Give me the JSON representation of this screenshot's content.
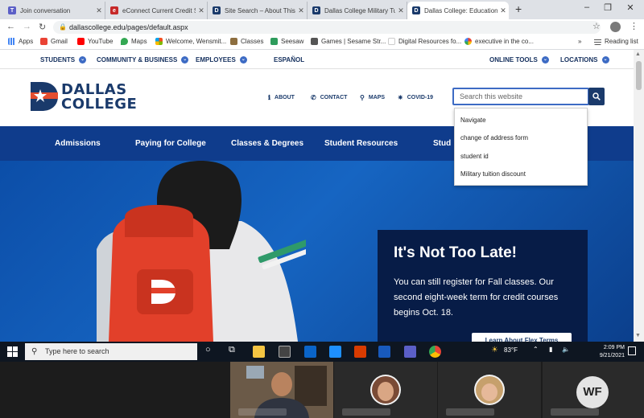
{
  "browser": {
    "tabs": [
      {
        "label": "Join conversation",
        "fav_color": "#5b5fc7",
        "fav_glyph": "T"
      },
      {
        "label": "eConnect Current Credit S",
        "fav_color": "#c62828",
        "fav_glyph": "e"
      },
      {
        "label": "Site Search – About This",
        "fav_color": "#1a3a6b",
        "fav_glyph": "D"
      },
      {
        "label": "Dallas College Military Tu",
        "fav_color": "#1a3a6b",
        "fav_glyph": "D"
      },
      {
        "label": "Dallas College: Education",
        "fav_color": "#1a3a6b",
        "fav_glyph": "D"
      }
    ],
    "new_tab": "+",
    "url": "dallascollege.edu/pages/default.aspx",
    "bookmarks": [
      {
        "label": "Apps",
        "color": "#4285f4"
      },
      {
        "label": "Gmail",
        "color": "#ea4335"
      },
      {
        "label": "YouTube",
        "color": "#ff0000"
      },
      {
        "label": "Maps",
        "color": "#34a853"
      },
      {
        "label": "Welcome, Wensmit...",
        "color": "#f4b400"
      },
      {
        "label": "Classes",
        "color": "#8d6e3f"
      },
      {
        "label": "Seesaw",
        "color": "#2e9c5c"
      },
      {
        "label": "Games | Sesame Str...",
        "color": "#555555"
      },
      {
        "label": "Digital Resources fo...",
        "color": "#ffffff"
      },
      {
        "label": "executive in the co...",
        "color": "#4285f4"
      }
    ],
    "more_bookmarks": "»",
    "reading_list": "Reading list"
  },
  "site": {
    "utility_nav": {
      "left": [
        "STUDENTS",
        "COMMUNITY & BUSINESS",
        "EMPLOYEES"
      ],
      "spanish": "ESPAÑOL",
      "right": [
        "ONLINE TOOLS",
        "LOCATIONS"
      ]
    },
    "logo": {
      "line1": "DALLAS",
      "line2": "COLLEGE"
    },
    "top_links": [
      {
        "label": "ABOUT",
        "icon": "info-icon"
      },
      {
        "label": "CONTACT",
        "icon": "phone-icon"
      },
      {
        "label": "MAPS",
        "icon": "map-pin-icon"
      },
      {
        "label": "COVID-19",
        "icon": "virus-icon"
      }
    ],
    "search": {
      "placeholder": "Search this website"
    },
    "suggestions": [
      "Navigate",
      "change of address form",
      "student id",
      "Military tuition discount"
    ],
    "main_nav": [
      "Admissions",
      "Paying for College",
      "Classes & Degrees",
      "Student Resources",
      "Stud"
    ],
    "promo": {
      "title": "It's Not Too Late!",
      "body": "You can still register for Fall classes. Our second eight-week term for credit courses begins Oct. 18.",
      "button": "Learn About Flex Terms"
    },
    "colors": {
      "navy": "#1a3a6b",
      "nav_blue": "#0f3c8c",
      "accent": "#3d6bc4",
      "promo_bg": "#071c47"
    }
  },
  "taskbar": {
    "search_placeholder": "Type here to search",
    "weather": "83°F",
    "time": "2:09 PM",
    "date": "9/21/2021"
  },
  "call": {
    "initials": "WF"
  }
}
